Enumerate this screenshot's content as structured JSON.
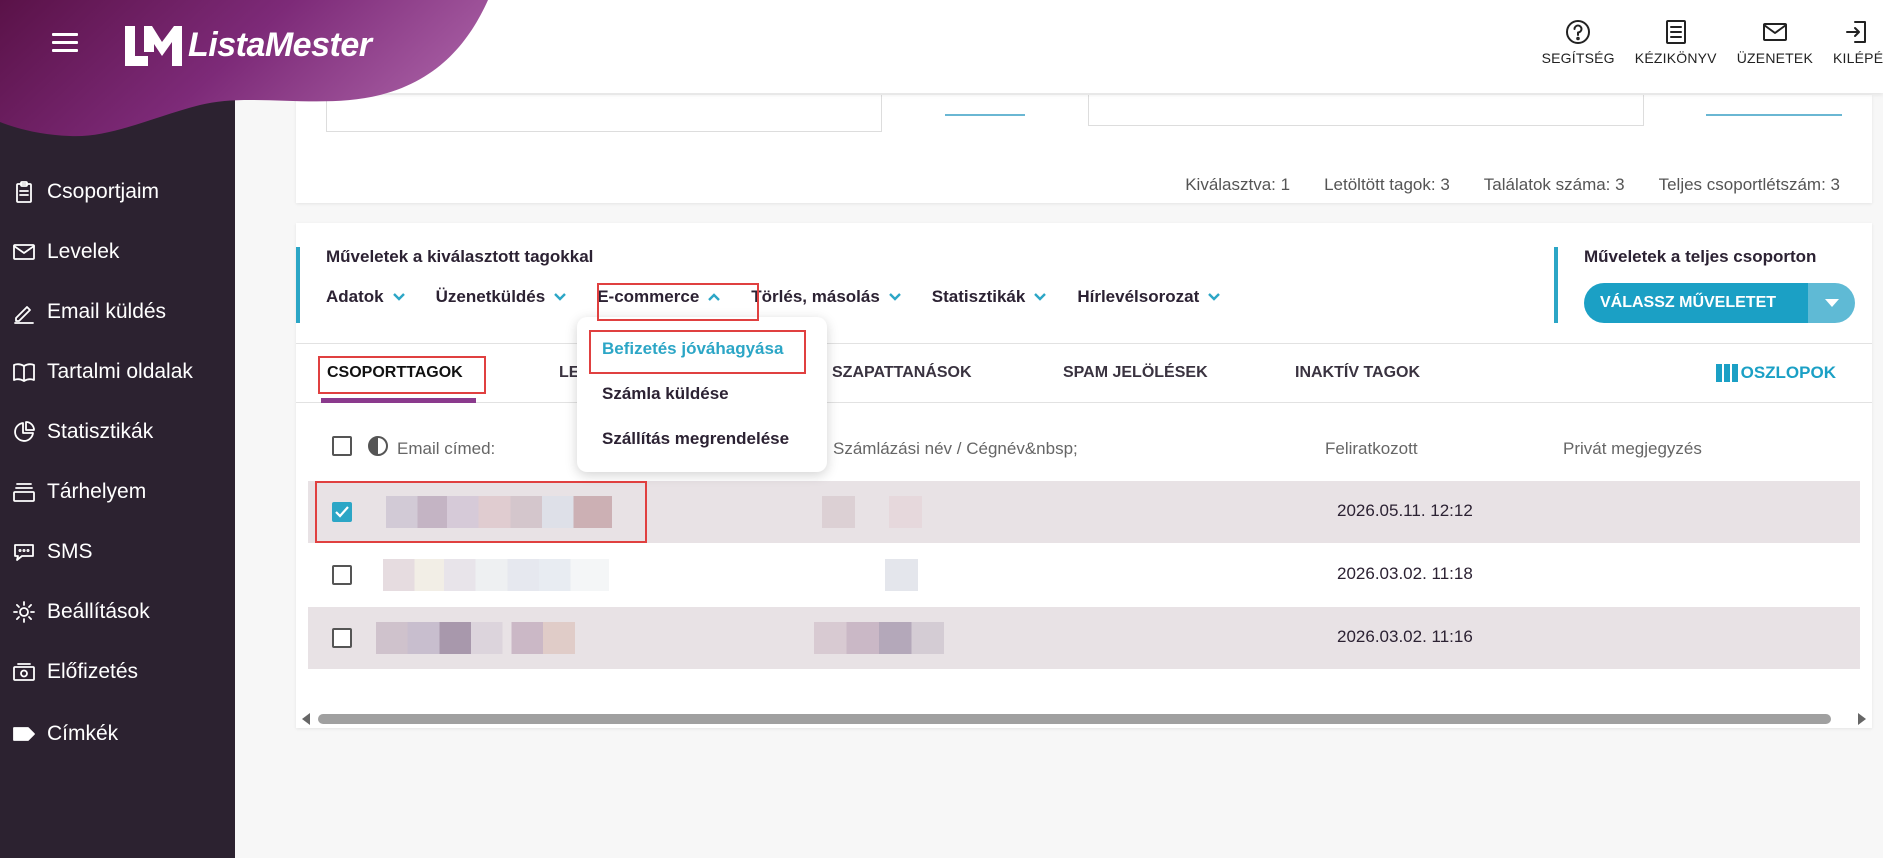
{
  "brand": {
    "name": "ListaMester"
  },
  "top_actions": [
    {
      "label": "SEGÍTSÉG",
      "icon": "help-circle-icon"
    },
    {
      "label": "KÉZIKÖNYV",
      "icon": "manual-icon"
    },
    {
      "label": "ÜZENETEK",
      "icon": "envelope-icon"
    },
    {
      "label": "KILÉPÉ",
      "icon": "logout-icon"
    }
  ],
  "sidebar": {
    "items": [
      {
        "label": "Csoportjaim",
        "icon": "clipboard-icon"
      },
      {
        "label": "Levelek",
        "icon": "envelope-icon"
      },
      {
        "label": "Email küldés",
        "icon": "pencil-icon"
      },
      {
        "label": "Tartalmi oldalak",
        "icon": "book-icon"
      },
      {
        "label": "Statisztikák",
        "icon": "pie-chart-icon"
      },
      {
        "label": "Tárhelyem",
        "icon": "storage-icon"
      },
      {
        "label": "SMS",
        "icon": "chat-bubble-icon"
      },
      {
        "label": "Beállítások",
        "icon": "gear-icon"
      },
      {
        "label": "Előfizetés",
        "icon": "subscription-icon"
      },
      {
        "label": "Címkék",
        "icon": "tag-icon"
      }
    ]
  },
  "summary": {
    "selected": "Kiválasztva: 1",
    "downloaded": "Letöltött tagok: 3",
    "results": "Találatok száma: 3",
    "total": "Teljes csoportlétszám: 3"
  },
  "ops": {
    "selected_title": "Műveletek a kiválasztott tagokkal",
    "menu": [
      "Adatok",
      "Üzenetküldés",
      "E-commerce",
      "Törlés, másolás",
      "Statisztikák",
      "Hírlevélsorozat"
    ],
    "group_title": "Műveletek a teljes csoporton",
    "group_button": "VÁLASSZ MŰVELETET"
  },
  "ecommerce_dropdown": [
    "Befizetés jóváhagyása",
    "Számla küldése",
    "Szállítás megrendelése"
  ],
  "tabs": [
    "CSOPORTTAGOK",
    "LE",
    "SZAPATTANÁSOK",
    "SPAM JELÖLÉSEK",
    "INAKTÍV TAGOK"
  ],
  "columns_button": "OSZLOPOK",
  "table": {
    "headers": {
      "email": "Email címed:",
      "billing": "Számlázási név / Cégnév&nbsp;",
      "subscribed": "Feliratkozott",
      "note": "Privát megjegyzés"
    },
    "rows": [
      {
        "subscribed": "2026.05.11. 12:12",
        "checked": true
      },
      {
        "subscribed": "2026.03.02. 11:18",
        "checked": false
      },
      {
        "subscribed": "2026.03.02. 11:16",
        "checked": false
      }
    ]
  },
  "colors": {
    "accent": "#2ca6c6",
    "brand_purple": "#8b3a8d",
    "sidebar": "#2c2230",
    "highlight": "#e04040"
  }
}
